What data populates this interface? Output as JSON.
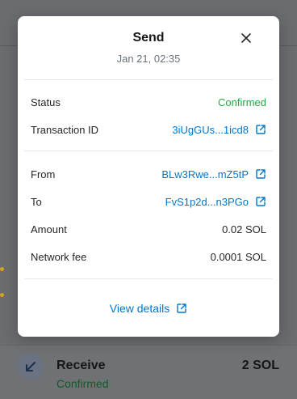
{
  "modal": {
    "title": "Send",
    "subtitle": "Jan 21, 02:35"
  },
  "details": {
    "status_label": "Status",
    "status_value": "Confirmed",
    "txid_label": "Transaction ID",
    "txid_value": "3iUgGUs...1icd8",
    "from_label": "From",
    "from_value": "BLw3Rwe...mZ5tP",
    "to_label": "To",
    "to_value": "FvS1p2d...n3PGo",
    "amount_label": "Amount",
    "amount_value": "0.02 SOL",
    "fee_label": "Network fee",
    "fee_value": "0.0001 SOL"
  },
  "view_details_label": "View details",
  "background_item": {
    "title": "Receive",
    "status": "Confirmed",
    "amount": "2 SOL"
  },
  "colors": {
    "accent_link": "#0376c9",
    "success": "#28a745"
  },
  "icons": [
    "close-icon",
    "external-link-icon",
    "receive-icon"
  ]
}
